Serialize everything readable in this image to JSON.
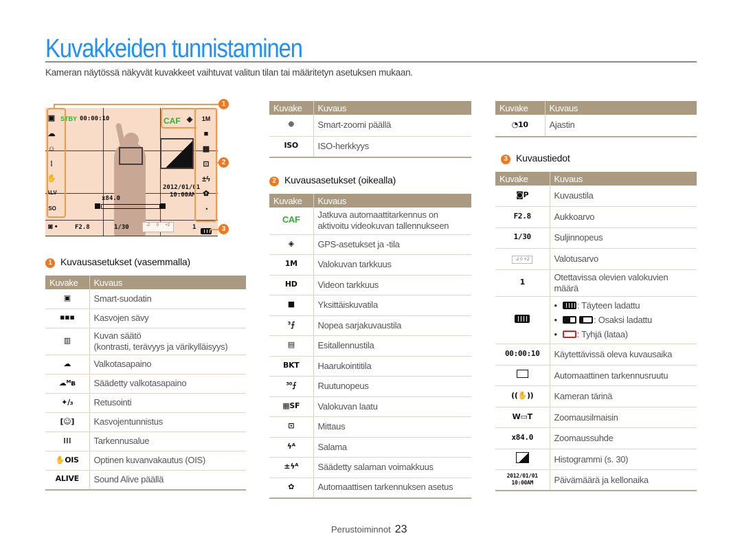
{
  "header": {
    "title": "Kuvakkeiden tunnistaminen",
    "intro": "Kameran näytössä näkyvät kuvakkeet vaihtuvat valitun tilan tai määritetyn asetuksen mukaan."
  },
  "preview": {
    "stby": "STBY",
    "timer": "00:00:10",
    "caf": "CAF",
    "zoom_ratio": "x84.0",
    "date": "2012/01/01",
    "time": "10:00AM",
    "aperture": "F2.8",
    "shutter": "1/30",
    "ev_labels": [
      "-2",
      "0",
      "+2"
    ],
    "shots_remaining": "1",
    "callouts": [
      "1",
      "2",
      "3"
    ],
    "colors": {
      "accent": "#f07820",
      "green": "#2bb52b",
      "bg": "#f9dcc8"
    }
  },
  "table_headers": {
    "icon": "Kuvake",
    "desc": "Kuvaus"
  },
  "section1": {
    "num": "1",
    "title": "Kuvausasetukset (vasemmalla)",
    "rows": [
      {
        "icon": "smart-filter-icon",
        "glyph": "▣",
        "desc": "Smart-suodatin"
      },
      {
        "icon": "face-tone-icon",
        "glyph": "▪▪▪",
        "desc": "Kasvojen sävy"
      },
      {
        "icon": "image-adjust-icon",
        "glyph": "▥",
        "desc": "Kuvan säätö",
        "desc2": "(kontrasti, terävyys ja värikylläisyys)"
      },
      {
        "icon": "white-balance-icon",
        "glyph": "☁",
        "desc": "Valkotasapaino"
      },
      {
        "icon": "custom-white-balance-icon",
        "glyph": "☁ᴹʙ",
        "desc": "Säädetty valkotasapaino"
      },
      {
        "icon": "retouch-icon",
        "glyph": "✦/₃",
        "desc": "Retusointi"
      },
      {
        "icon": "face-detection-icon",
        "glyph": "[☺]",
        "desc": "Kasvojentunnistus"
      },
      {
        "icon": "focus-area-icon",
        "glyph": "⁞⁞⁞",
        "desc": "Tarkennusalue"
      },
      {
        "icon": "ois-icon",
        "glyph": "✋OIS",
        "desc": "Optinen kuvanvakautus (OIS)"
      },
      {
        "icon": "sound-alive-icon",
        "glyph": "ALIVE",
        "desc": "Sound Alive päällä"
      }
    ]
  },
  "section1b": {
    "rows": [
      {
        "icon": "smart-zoom-icon",
        "glyph": "⊕",
        "desc": "Smart-zoomi päällä"
      },
      {
        "icon": "iso-icon",
        "glyph": "ISO",
        "desc": "ISO-herkkyys"
      }
    ]
  },
  "section2": {
    "num": "2",
    "title": "Kuvausasetukset (oikealla)",
    "rows": [
      {
        "icon": "caf-icon",
        "glyph": "CAF",
        "desc": "Jatkuva automaattitarkennus on aktivoitu videokuvan tallennukseen"
      },
      {
        "icon": "gps-icon",
        "glyph": "◈",
        "desc": "GPS-asetukset ja -tila"
      },
      {
        "icon": "photo-resolution-icon",
        "glyph": "1M",
        "desc": "Valokuvan tarkkuus"
      },
      {
        "icon": "video-resolution-icon",
        "glyph": "HD",
        "desc": "Videon tarkkuus"
      },
      {
        "icon": "single-shot-icon",
        "glyph": "■",
        "desc": "Yksittäiskuvatila"
      },
      {
        "icon": "burst-icon",
        "glyph": "³⨍",
        "desc": "Nopea sarjakuvaustila"
      },
      {
        "icon": "pre-capture-icon",
        "glyph": "▤",
        "desc": "Esitallennustila"
      },
      {
        "icon": "bracketing-icon",
        "glyph": "BKT",
        "desc": "Haarukointitila"
      },
      {
        "icon": "frame-rate-icon",
        "glyph": "³⁰⨍",
        "desc": "Ruutunopeus"
      },
      {
        "icon": "photo-quality-icon",
        "glyph": "▦SF",
        "desc": "Valokuvan laatu"
      },
      {
        "icon": "metering-icon",
        "glyph": "⊡",
        "desc": "Mittaus"
      },
      {
        "icon": "flash-icon",
        "glyph": "ϟᴬ",
        "desc": "Salama"
      },
      {
        "icon": "flash-ev-icon",
        "glyph": "±ϟᴬ",
        "desc": "Säädetty salaman voimakkuus"
      },
      {
        "icon": "macro-icon",
        "glyph": "✿",
        "desc": "Automaattisen tarkennuksen asetus"
      }
    ]
  },
  "section2b": {
    "rows": [
      {
        "icon": "timer-icon",
        "glyph": "◔10",
        "desc": "Ajastin"
      }
    ]
  },
  "section3": {
    "num": "3",
    "title": "Kuvaustiedot",
    "rows": [
      {
        "icon": "shooting-mode-icon",
        "glyph": "◙P",
        "desc": "Kuvaustila"
      },
      {
        "icon": "aperture-icon",
        "glyph": "F2.8",
        "desc": "Aukkoarvo"
      },
      {
        "icon": "shutter-speed-icon",
        "glyph": "1/30",
        "desc": "Suljinnopeus"
      },
      {
        "icon": "exposure-value-icon",
        "glyph": "-2 0 +2",
        "desc": "Valotusarvo"
      },
      {
        "icon": "shots-remaining-icon",
        "glyph": "1",
        "desc": "Otettavissa olevien valokuvien määrä"
      },
      {
        "icon": "battery-icon",
        "glyph": "",
        "desc": "",
        "bullets": [
          ": Täyteen ladattu",
          ": Osaksi ladattu",
          ": Tyhjä (lataa)"
        ]
      },
      {
        "icon": "recording-time-icon",
        "glyph": "00:00:10",
        "desc": "Käytettävissä oleva kuvausaika"
      },
      {
        "icon": "af-frame-icon",
        "glyph": "□",
        "desc": "Automaattinen tarkennusruutu"
      },
      {
        "icon": "camera-shake-icon",
        "glyph": "((✋))",
        "desc": "Kameran tärinä"
      },
      {
        "icon": "zoom-indicator-icon",
        "glyph": "W▭T",
        "desc": "Zoomausilmaisin"
      },
      {
        "icon": "zoom-ratio-icon",
        "glyph": "x84.0",
        "desc": "Zoomaussuhde"
      },
      {
        "icon": "histogram-icon",
        "glyph": "◢",
        "desc": "Histogrammi (s. 30)"
      },
      {
        "icon": "date-time-icon",
        "glyph": "2012/01/01 10:00AM",
        "desc": "Päivämäärä ja kellonaika"
      }
    ]
  },
  "footer": {
    "section": "Perustoiminnot",
    "page": "23"
  }
}
